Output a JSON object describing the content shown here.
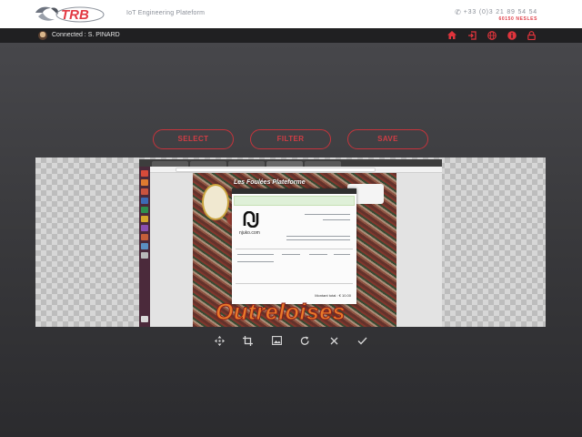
{
  "header": {
    "logo_text": "TRB",
    "tagline": "IoT Engineering Plateform",
    "phone": "+33 (0)3 21 89 54 54",
    "city": "60150 NESLES"
  },
  "navbar": {
    "connected_text": "Connected : S. PINARD",
    "icons": [
      "home-icon",
      "sign-in-icon",
      "globe-icon",
      "info-icon",
      "lock-icon"
    ],
    "icon_color": "#e0343c"
  },
  "actions": {
    "select_label": "SELECT",
    "filter_label": "FILTER",
    "save_label": "SAVE",
    "accent_color": "#d23d45"
  },
  "viewer": {
    "page_title": "Les Foulées Plateforme",
    "banner_word": "Outreloises",
    "receipt_brand": "njuko.com",
    "receipt_total": "Montant total : € 10.00"
  },
  "toolbar": {
    "tools": [
      "move-icon",
      "crop-icon",
      "image-icon",
      "rotate-icon",
      "cancel-icon",
      "confirm-icon"
    ]
  }
}
